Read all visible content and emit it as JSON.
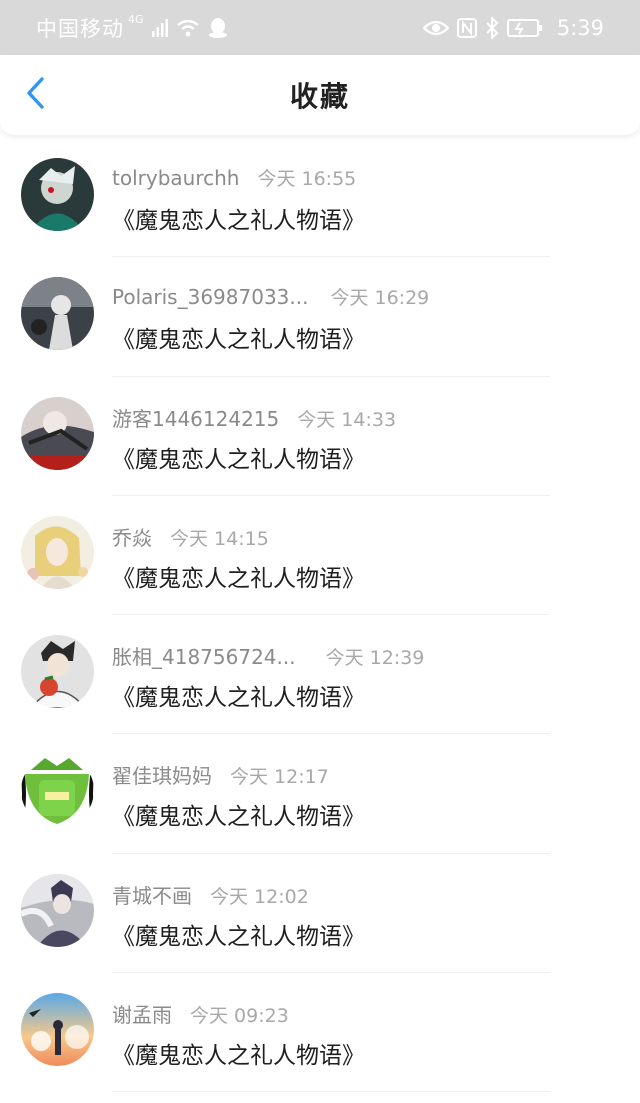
{
  "status_bar": {
    "carrier": "中国移动",
    "network": "4G",
    "time": "5:39",
    "icons": [
      "signal-icon",
      "wifi-icon",
      "qq-icon",
      "eye-icon",
      "nfc-icon",
      "bluetooth-icon",
      "battery-icon"
    ]
  },
  "header": {
    "title": "收藏",
    "back_icon": "chevron-left-icon"
  },
  "colors": {
    "accent": "#2f96f3",
    "status_bar_bg": "#d9d9d9",
    "text_primary": "#1f1f1f",
    "text_secondary": "#8a8a8a"
  },
  "favorites": [
    {
      "username": "tolrybaurchh",
      "time": "今天 16:55",
      "title": "《魔鬼恋人之礼人物语》"
    },
    {
      "username": "Polaris_36987033...",
      "time": "今天 16:29",
      "title": "《魔鬼恋人之礼人物语》"
    },
    {
      "username": "游客1446124215",
      "time": "今天 14:33",
      "title": "《魔鬼恋人之礼人物语》"
    },
    {
      "username": "乔焱",
      "time": "今天 14:15",
      "title": "《魔鬼恋人之礼人物语》"
    },
    {
      "username": "胀相_418756724...",
      "time": "今天 12:39",
      "title": "《魔鬼恋人之礼人物语》"
    },
    {
      "username": "翟佳琪妈妈",
      "time": "今天 12:17",
      "title": "《魔鬼恋人之礼人物语》"
    },
    {
      "username": "青城不画",
      "time": "今天 12:02",
      "title": "《魔鬼恋人之礼人物语》"
    },
    {
      "username": "谢孟雨",
      "time": "今天 09:23",
      "title": "《魔鬼恋人之礼人物语》"
    }
  ]
}
